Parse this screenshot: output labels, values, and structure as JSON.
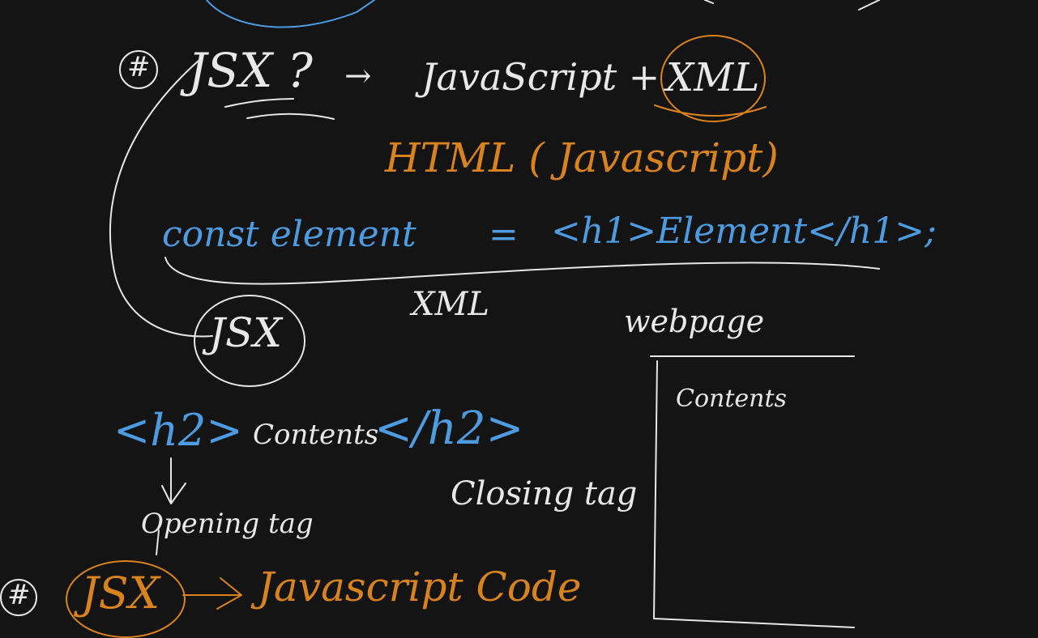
{
  "colors": {
    "background": "#141414",
    "ink_white": "#e8e8e8",
    "ink_orange": "#d9831f",
    "ink_blue": "#4d9be0"
  },
  "board": {
    "hash_mark_1": "#",
    "jsx_question": "JSX ?",
    "arrow_1": "→",
    "javascript_plus": "JavaScript +",
    "xml_circled": "XML",
    "html_javascript": "HTML ( Javascript)",
    "const_element": "const element",
    "equals": "=",
    "h1_element": "<h1>Element</h1>;",
    "xml_label": "XML",
    "jsx_circled": "JSX",
    "webpage_label": "webpage",
    "contents_box_text": "Contents",
    "h2_open": "<h2>",
    "h2_content": "Contents",
    "h2_close": "</h2>",
    "opening_tag": "Opening tag",
    "closing_tag": "Closing tag",
    "hash_mark_2": "#",
    "jsx_bottom": "JSX",
    "javascript_code": "Javascript Code"
  }
}
